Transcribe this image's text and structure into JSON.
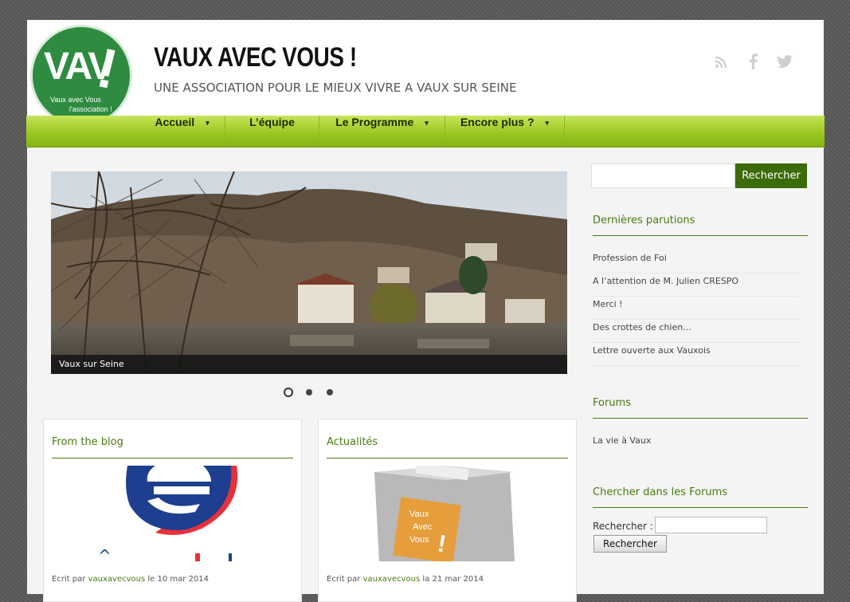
{
  "header": {
    "logo": {
      "main": "VAV",
      "bang": "!",
      "line1": "Vaux avec Vous",
      "line2": "l'association !"
    },
    "title": "VAUX AVEC VOUS !",
    "tagline": "UNE ASSOCIATION POUR LE MIEUX VIVRE A VAUX SUR SEINE",
    "social": {
      "rss": "))",
      "facebook": "f",
      "twitter": "t"
    }
  },
  "nav": {
    "items": [
      {
        "label": "Accueil",
        "arrow": "▾"
      },
      {
        "label": "L’équipe"
      },
      {
        "label": "Le Programme",
        "arrow": "▾"
      },
      {
        "label": "Encore plus ?",
        "arrow": "▾"
      }
    ]
  },
  "slider": {
    "caption": "Vaux sur Seine",
    "active_slide": 1,
    "slide_count": 3
  },
  "cards": [
    {
      "title": "From the blog",
      "meta_prefix": "Ecrit par",
      "author": "vauxavecvous",
      "meta_mid": "le",
      "date": "10 mar 2014"
    },
    {
      "title": "Actualités",
      "box_text": [
        "Vaux",
        "Avec",
        "Vous"
      ],
      "meta_prefix": "Ecrit par",
      "author": "vauxavecvous",
      "meta_mid": "la",
      "date": "21 mar 2014"
    }
  ],
  "sidebar": {
    "search": {
      "placeholder": "",
      "button": "Rechercher"
    },
    "recent": {
      "title": "Dernières parutions",
      "items": [
        "Profession de Foi",
        "A l’attention de M. Julien CRESPO",
        "Merci !",
        "Des crottes de chien…",
        "Lettre ouverte aux Vauxois"
      ]
    },
    "forums": {
      "title": "Forums",
      "items": [
        "La vie à Vaux"
      ]
    },
    "forum_search": {
      "title": "Chercher dans les Forums",
      "label": "Rechercher :",
      "button": "Rechercher"
    }
  },
  "colors": {
    "accent": "#4a7a10",
    "nav": "#96c51c",
    "logo": "#2e8b3f"
  }
}
